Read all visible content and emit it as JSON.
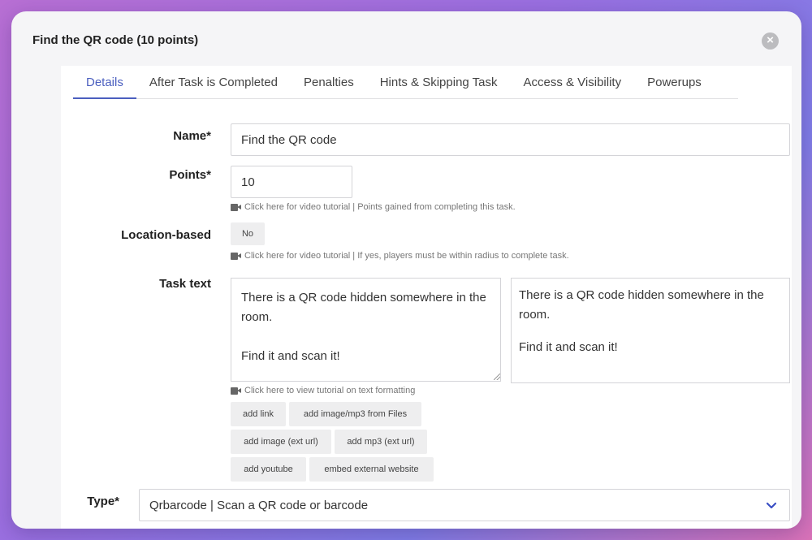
{
  "modal": {
    "title": "Find the QR code (10 points)",
    "close_glyph": "×"
  },
  "tabs": [
    {
      "label": "Details",
      "active": true
    },
    {
      "label": "After Task is Completed",
      "active": false
    },
    {
      "label": "Penalties",
      "active": false
    },
    {
      "label": "Hints & Skipping Task",
      "active": false
    },
    {
      "label": "Access & Visibility",
      "active": false
    },
    {
      "label": "Powerups",
      "active": false
    }
  ],
  "form": {
    "name": {
      "label": "Name*",
      "value": "Find the QR code"
    },
    "points": {
      "label": "Points*",
      "value": "10",
      "hint": "Click here for video tutorial | Points gained from completing this task."
    },
    "location": {
      "label": "Location-based",
      "value": "No",
      "hint": "Click here for video tutorial | If yes, players must be within radius to complete task."
    },
    "task_text": {
      "label": "Task text",
      "value": "There is a QR code hidden somewhere in the room.\n\nFind it and scan it!",
      "preview_lines": [
        "There is a QR code hidden somewhere in the room.",
        "Find it and scan it!"
      ],
      "hint": "Click here to view tutorial on text formatting"
    },
    "buttons": {
      "add_link": "add link",
      "add_image_files": "add image/mp3 from Files",
      "add_image_url": "add image (ext url)",
      "add_mp3_url": "add mp3 (ext url)",
      "add_youtube": "add youtube",
      "embed_website": "embed external website"
    },
    "type": {
      "label": "Type*",
      "value": "Qrbarcode | Scan a QR code or barcode"
    }
  },
  "colors": {
    "accent": "#4b5fbf",
    "chevron": "#3a4fc4"
  },
  "icons": {
    "close": "close-icon",
    "video": "video-camera-icon",
    "dropdown": "chevron-down-icon"
  }
}
